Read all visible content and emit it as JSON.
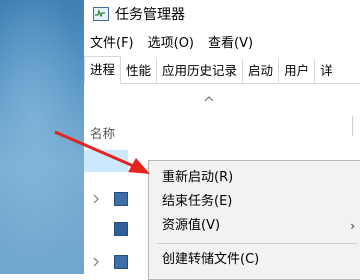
{
  "window": {
    "title": "任务管理器",
    "icon": "task-manager-icon"
  },
  "menubar": {
    "items": [
      "文件(F)",
      "选项(O)",
      "查看(V)"
    ]
  },
  "tabs": {
    "items": [
      "进程",
      "性能",
      "应用历史记录",
      "启动",
      "用户"
    ],
    "partial": "详",
    "active_index": 0
  },
  "table": {
    "sort_indicator": "chevron-up-icon",
    "columns": [
      "名称"
    ]
  },
  "context_menu": {
    "items": [
      {
        "label": "重新启动(R)"
      },
      {
        "label": "结束任务(E)"
      },
      {
        "label": "资源值(V)",
        "submenu_indicator": "›"
      },
      {
        "label": "创建转储文件(C)"
      }
    ]
  },
  "annotation": {
    "arrow_color": "#e5231f"
  },
  "colors": {
    "selection": "#cce8ff",
    "menu_background": "#f2f2f2"
  }
}
